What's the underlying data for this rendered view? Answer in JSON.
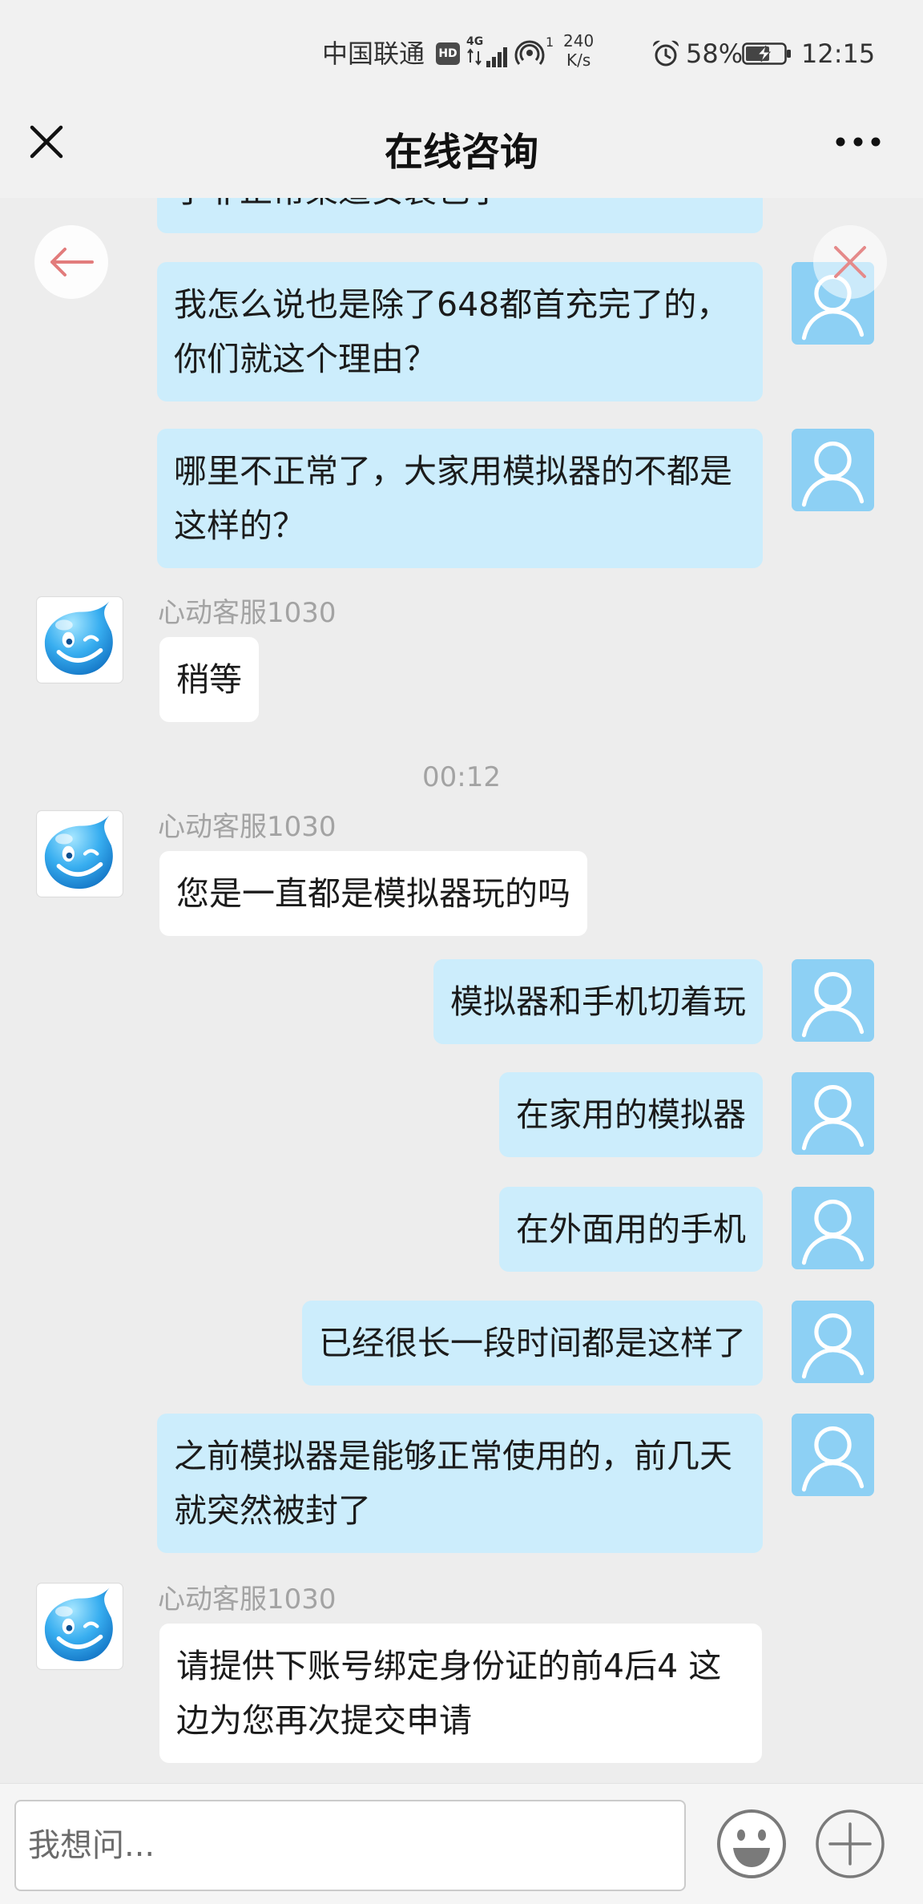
{
  "status_bar": {
    "carrier": "中国联通",
    "hd_badge": "HD",
    "network_type": "4G",
    "hotspot_count": "1",
    "speed_value": "240",
    "speed_unit": "K/s",
    "battery_percent": "58%",
    "time": "12:15",
    "icons": [
      "hd-icon",
      "signal-icon",
      "hotspot-icon",
      "alarm-icon",
      "battery-charging-icon"
    ]
  },
  "header": {
    "title": "在线咨询",
    "close_icon": "close-icon",
    "more_icon": "more-icon"
  },
  "floating_buttons": {
    "back_icon": "arrow-left-icon",
    "close_icon": "close-icon"
  },
  "messages": [
    {
      "sender": "user",
      "lines": [
        "了非正常渠道安装包了"
      ]
    },
    {
      "sender": "user",
      "lines": [
        "我怎么说也是除了648都首充完了的，",
        "你们就这个理由？"
      ]
    },
    {
      "sender": "user",
      "lines": [
        "哪里不正常了，大家用模拟器的不都是",
        "这样的？"
      ]
    },
    {
      "sender": "agent",
      "name": "心动客服1030",
      "lines": [
        "稍等"
      ]
    },
    {
      "type": "timestamp",
      "text": "00:12"
    },
    {
      "sender": "agent",
      "name": "心动客服1030",
      "lines": [
        "您是一直都是模拟器玩的吗"
      ]
    },
    {
      "sender": "user",
      "lines": [
        "模拟器和手机切着玩"
      ]
    },
    {
      "sender": "user",
      "lines": [
        "在家用的模拟器"
      ]
    },
    {
      "sender": "user",
      "lines": [
        "在外面用的手机"
      ]
    },
    {
      "sender": "user",
      "lines": [
        "已经很长一段时间都是这样了"
      ]
    },
    {
      "sender": "user",
      "lines": [
        "之前模拟器是能够正常使用的，前几天",
        "就突然被封了"
      ]
    },
    {
      "sender": "agent",
      "name": "心动客服1030",
      "lines": [
        "请提供下账号绑定身份证的前4后4 这",
        "边为您再次提交申请"
      ]
    }
  ],
  "avatars": {
    "user": "person-icon",
    "agent": "water-drop-mascot-icon"
  },
  "composer": {
    "placeholder": "我想问...",
    "emoji_icon": "emoji-icon",
    "plus_icon": "plus-icon"
  },
  "colors": {
    "header_bg": "#f1f1f1",
    "chat_bg": "#ededed",
    "user_bubble": "#ccedfc",
    "agent_bubble": "#ffffff",
    "user_avatar": "#8dd0f4",
    "agent_name": "#a3a3a3",
    "floating_accent": "#e27c7c"
  }
}
